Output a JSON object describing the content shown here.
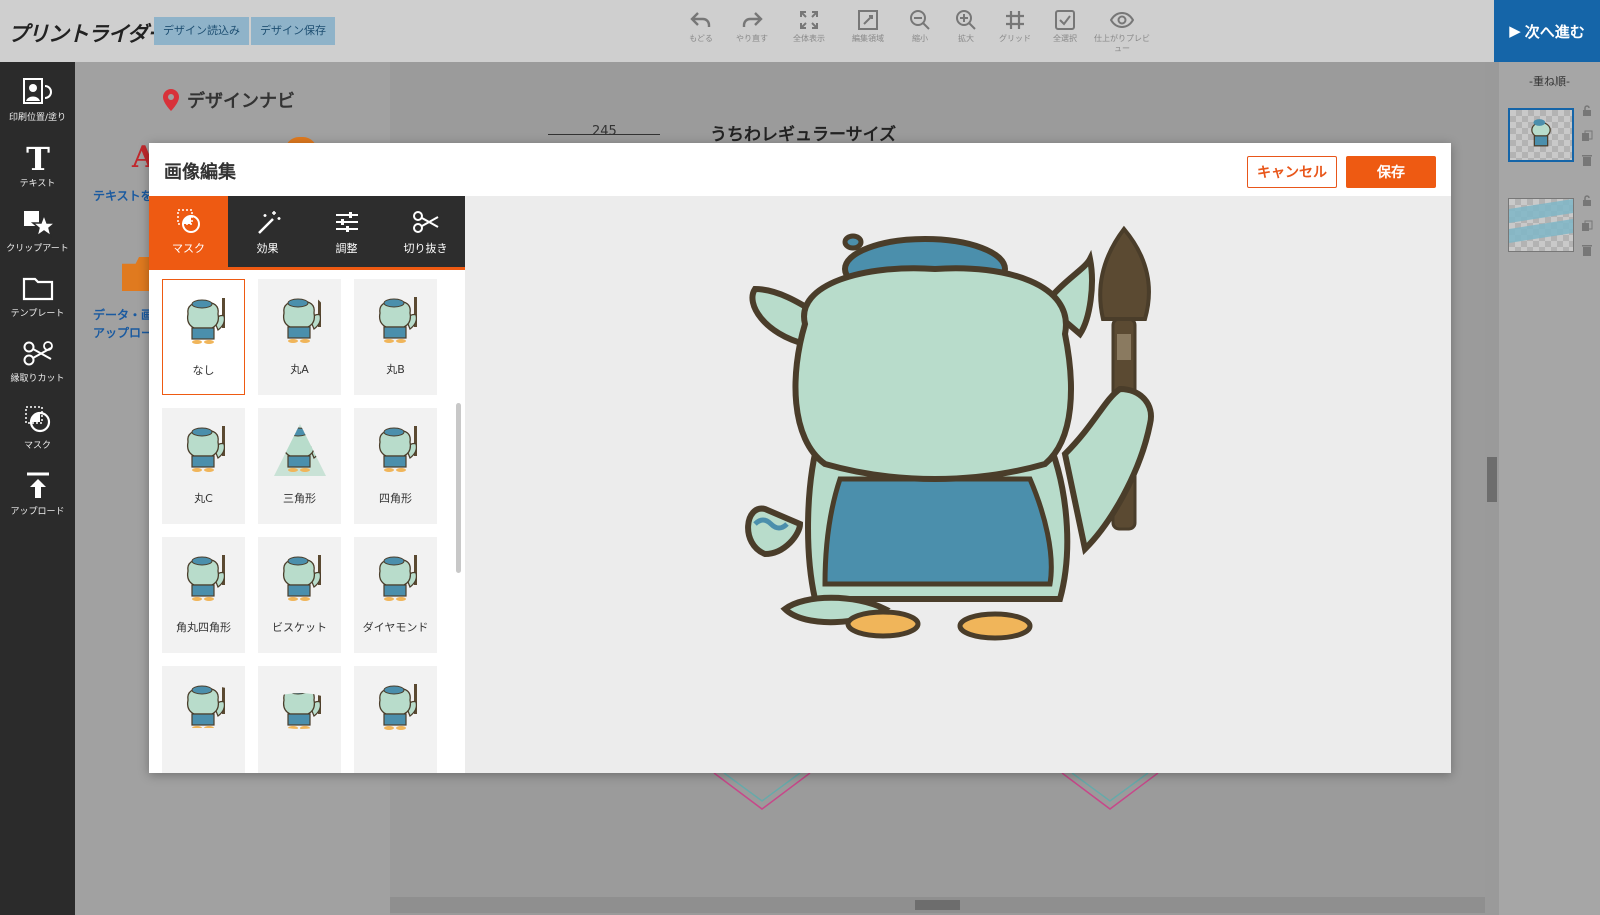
{
  "app": {
    "logo": "プリントライダー",
    "buttons": {
      "load_design": "デザイン読込み",
      "save_design": "デザイン保存",
      "next": "次へ進む"
    }
  },
  "toolbar": [
    {
      "label": "もどる",
      "icon": "undo-icon"
    },
    {
      "label": "やり直す",
      "icon": "redo-icon"
    },
    {
      "label": "全体表示",
      "icon": "fit-screen-icon"
    },
    {
      "label": "編集領域",
      "icon": "edit-area-icon"
    },
    {
      "label": "縮小",
      "icon": "zoom-out-icon"
    },
    {
      "label": "拡大",
      "icon": "zoom-in-icon"
    },
    {
      "label": "グリッド",
      "icon": "grid-icon"
    },
    {
      "label": "全選択",
      "icon": "select-all-icon"
    },
    {
      "label": "仕上がりプレビュー",
      "icon": "eye-icon"
    }
  ],
  "sidebar": [
    {
      "label": "印刷位置/塗り",
      "icon": "print-position-icon"
    },
    {
      "label": "テキスト",
      "icon": "text-icon"
    },
    {
      "label": "クリップアート",
      "icon": "clipart-icon"
    },
    {
      "label": "テンプレート",
      "icon": "folder-icon"
    },
    {
      "label": "縁取りカット",
      "icon": "scissors-icon"
    },
    {
      "label": "マスク",
      "icon": "mask-icon"
    },
    {
      "label": "アップロード",
      "icon": "upload-icon"
    }
  ],
  "navi": {
    "title": "デザインナビ",
    "links": [
      "テキストを",
      "データ・画",
      "アップロー"
    ]
  },
  "canvas": {
    "title": "うちわレギュラーサイズ",
    "dimension": "245"
  },
  "layers": {
    "title": "-重ね順-"
  },
  "modal": {
    "title": "画像編集",
    "cancel": "キャンセル",
    "save": "保存",
    "tabs": [
      {
        "label": "マスク",
        "icon": "mask-icon",
        "active": true
      },
      {
        "label": "効果",
        "icon": "magic-wand-icon",
        "active": false
      },
      {
        "label": "調整",
        "icon": "sliders-icon",
        "active": false
      },
      {
        "label": "切り抜き",
        "icon": "scissors-icon",
        "active": false
      }
    ],
    "masks": [
      {
        "label": "なし",
        "selected": true
      },
      {
        "label": "丸A",
        "selected": false
      },
      {
        "label": "丸B",
        "selected": false
      },
      {
        "label": "丸C",
        "selected": false
      },
      {
        "label": "三角形",
        "selected": false
      },
      {
        "label": "四角形",
        "selected": false
      },
      {
        "label": "角丸四角形",
        "selected": false
      },
      {
        "label": "ビスケット",
        "selected": false
      },
      {
        "label": "ダイヤモンド",
        "selected": false
      },
      {
        "label": "",
        "selected": false
      },
      {
        "label": "",
        "selected": false
      },
      {
        "label": "",
        "selected": false
      }
    ]
  },
  "colors": {
    "accent": "#ee5a12",
    "primary": "#1565a8",
    "sidebar_bg": "#2b2b2b",
    "character_body": "#b8dccb",
    "character_clothes": "#4b8fac",
    "character_outline": "#4a3d2a",
    "brush": "#5b4a32",
    "feet": "#f0b55a"
  }
}
